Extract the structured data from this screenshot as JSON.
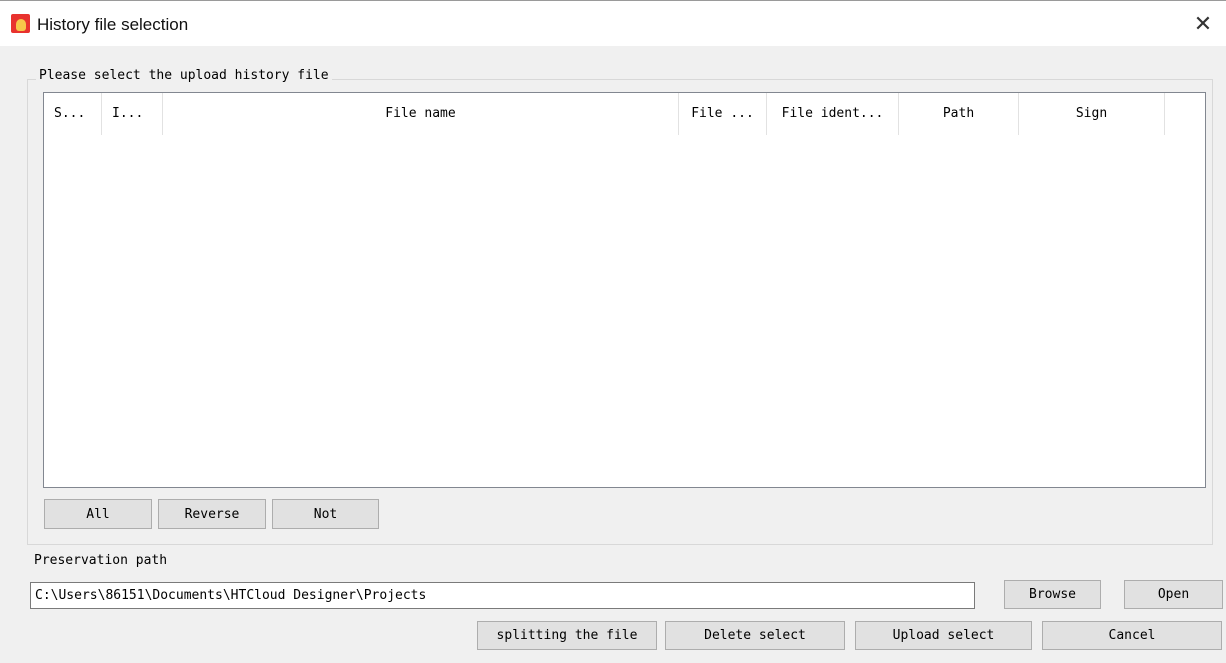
{
  "window": {
    "title": "History file selection",
    "close_glyph": "✕"
  },
  "group": {
    "legend": "Please select the upload history file"
  },
  "table": {
    "columns": [
      "S...",
      "I...",
      "File name",
      "File ...",
      "File ident...",
      "Path",
      "Sign"
    ],
    "rows": []
  },
  "selection_buttons": {
    "all": "All",
    "reverse": "Reverse",
    "not": "Not"
  },
  "preservation": {
    "label": "Preservation path",
    "path_value": "C:\\Users\\86151\\Documents\\HTCloud Designer\\Projects",
    "browse": "Browse",
    "open": "Open"
  },
  "actions": {
    "split": "splitting the file",
    "delete": "Delete select",
    "upload": "Upload select",
    "cancel": "Cancel"
  },
  "icons": {
    "app": "app-hand-icon",
    "close": "close-icon"
  }
}
